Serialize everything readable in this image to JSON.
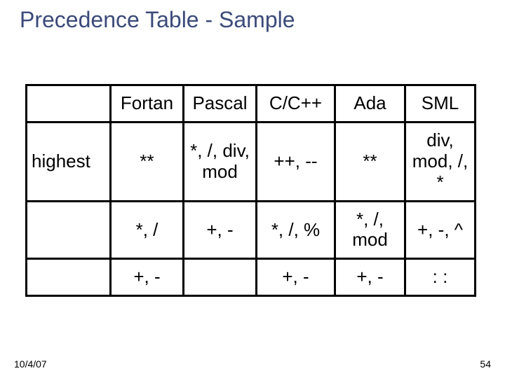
{
  "title": "Precedence Table - Sample",
  "columns": {
    "c0": "",
    "c1": "Fortan",
    "c2": "Pascal",
    "c3": "C/C++",
    "c4": "Ada",
    "c5": "SML"
  },
  "rows": [
    {
      "label": "highest",
      "c1": "**",
      "c2": "*, /, div, mod",
      "c3": "++, --",
      "c4": "**",
      "c5": "div, mod, /, *"
    },
    {
      "label": "",
      "c1": "*, /",
      "c2": "+, -",
      "c3": "*, /, %",
      "c4": "*, /, mod",
      "c5": "+, -, ^"
    },
    {
      "label": "",
      "c1": "+, -",
      "c2": "",
      "c3": "+, -",
      "c4": "+, -",
      "c5": ": :"
    }
  ],
  "footer": {
    "date": "10/4/07",
    "page": "54"
  }
}
